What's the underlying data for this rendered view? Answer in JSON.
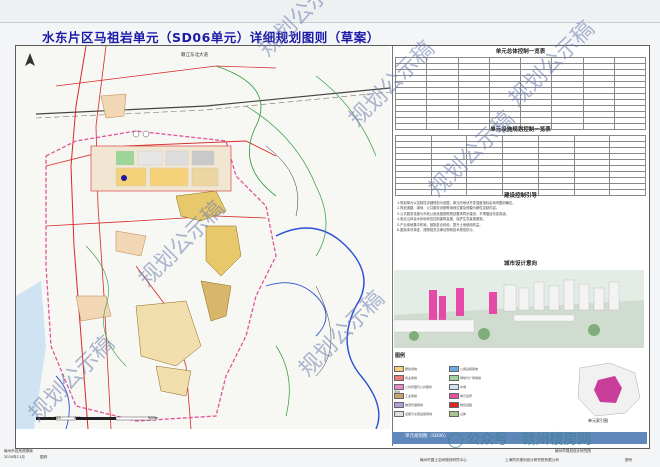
{
  "document": {
    "title": "水东片区马祖岩单元（SD06单元）详细规划图则（草案）",
    "map_label_road": "赣江东北大道",
    "panel_sections": {
      "overall_control": "单元总体控制一览表",
      "facility_control": "单元设施规划控制一览表",
      "construction_guide": "建设控制引导",
      "design_intent": "城市设计意向",
      "legend": "图例",
      "index_map": "单元索引图",
      "unit_plan_label": "单元规划图（SD06）"
    },
    "construction_notes": [
      "1.规划单元以控制性详细规划为依据，单元内地块开发强度指标由地块图则确定。",
      "2.规划道路、绿地、公共服务设施等用地位置及规模为刚性控制内容。",
      "3.公共服务设施与市政公用设施按照规划要求同步建设，不得擅自改变用途。",
      "4.临近山体及水系地块应控制建筑高度，保护生态景观廊道。",
      "5.产业用地集中布局，鼓励复合利用，提升土地使用效益。",
      "6.图则未尽事宜，按照相关法律法规和技术规范执行。"
    ],
    "footer": {
      "left_org": "赣州市自然资源局",
      "left_date": "2024年11月",
      "left_page": "图则",
      "right_top": "赣州市规划设计研究院",
      "right_org1": "赣州市国土空间规划研究中心",
      "right_org2": "上海同济规划设计研究院有限公司",
      "right_tag": "图号"
    },
    "watermarks": [
      "规划公示稿",
      "规划公示稿",
      "规划公示稿",
      "规划公示稿",
      "规划公示稿",
      "规划公示稿",
      "规划公示稿"
    ],
    "wechat": "公众号 · 赣州楼房网",
    "legend_items": [
      "居住用地",
      "商业用地",
      "公共管理与公共服务用地",
      "工业用地",
      "物流仓储用地",
      "道路与交通设施用地",
      "公用设施用地",
      "绿地与广场用地",
      "水域",
      "单元边界",
      "规划道路",
      "山体"
    ],
    "scale_labels": [
      "0",
      "125",
      "250",
      "500m"
    ],
    "compass_label": "N"
  },
  "colors": {
    "title": "#1a1aa8",
    "road_red": "#d62828",
    "boundary_pink": "#e0559c",
    "water_blue": "#2b4fd6",
    "green_line": "#2b9a3c",
    "residential": "#f5d27a",
    "industrial": "#c9a36b",
    "commercial": "#f07a7a",
    "strip": "#5f87ba"
  }
}
